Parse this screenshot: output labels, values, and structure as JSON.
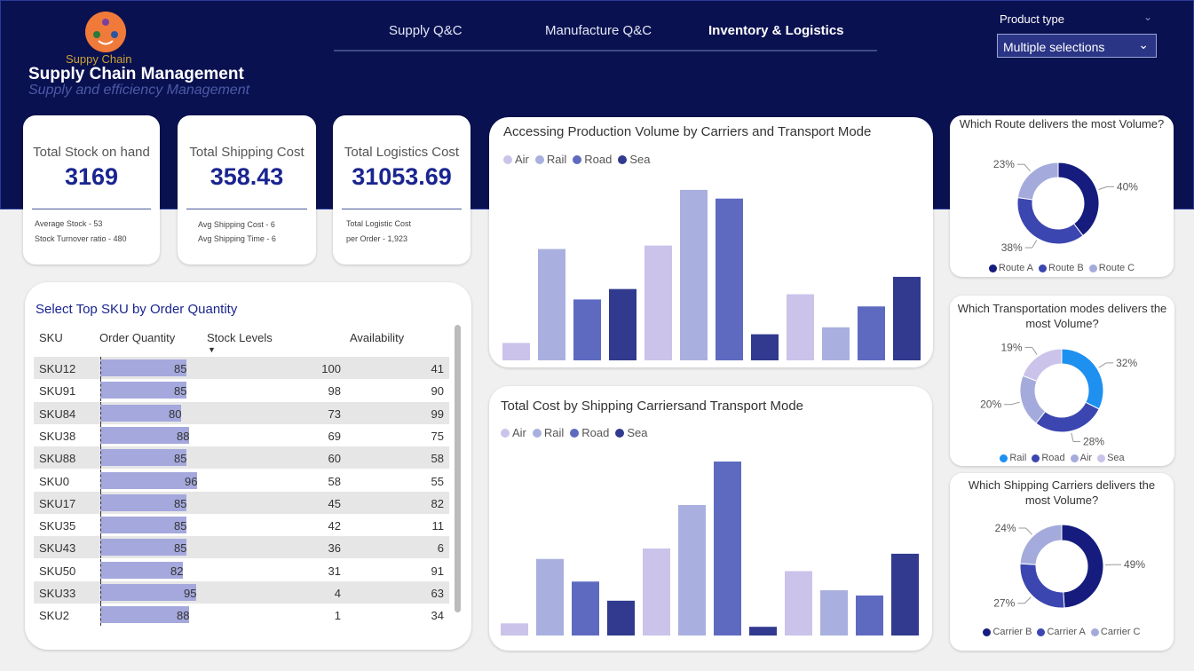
{
  "header": {
    "logo_text": "Suppy Chain",
    "title": "Supply Chain Management",
    "subtitle": "Supply and efficiency Management",
    "nav_tabs": [
      {
        "label": "Supply Q&C",
        "active": false
      },
      {
        "label": "Manufacture Q&C",
        "active": false
      },
      {
        "label": "Inventory & Logistics",
        "active": true
      }
    ],
    "filter": {
      "label": "Product type",
      "value": "Multiple selections"
    }
  },
  "kpis": [
    {
      "title": "Total Stock on hand",
      "value": "3169",
      "sub": [
        "Average Stock  -    53",
        "Stock Turnover ratio  -    480"
      ]
    },
    {
      "title": "Total Shipping Cost",
      "value": "358.43",
      "sub": [
        "Avg Shipping Cost - 6",
        "Avg Shipping Time - 6"
      ]
    },
    {
      "title": "Total Logistics Cost",
      "value": "31053.69",
      "sub": [
        "Total Logistic Cost",
        "per Order -    1,923"
      ]
    }
  ],
  "colors": {
    "Air": "#cbc3ea",
    "Rail": "#a9b0df",
    "Road": "#5e6ac0",
    "Sea": "#313a8e",
    "Rail_blue": "#1e90f0"
  },
  "chart_data": [
    {
      "type": "bar",
      "title": "Accessing Production Volume by Carriers and Transport Mode",
      "legend": [
        "Air",
        "Rail",
        "Road",
        "Sea"
      ],
      "bars": [
        {
          "mode": "Air",
          "value": 10
        },
        {
          "mode": "Rail",
          "value": 64
        },
        {
          "mode": "Road",
          "value": 35
        },
        {
          "mode": "Sea",
          "value": 41
        },
        {
          "mode": "Air",
          "value": 66
        },
        {
          "mode": "Rail",
          "value": 98
        },
        {
          "mode": "Road",
          "value": 93
        },
        {
          "mode": "Sea",
          "value": 15
        },
        {
          "mode": "Air",
          "value": 38
        },
        {
          "mode": "Rail",
          "value": 19
        },
        {
          "mode": "Road",
          "value": 31
        },
        {
          "mode": "Sea",
          "value": 48
        }
      ],
      "ylim": [
        0,
        100
      ]
    },
    {
      "type": "bar",
      "title": "Total Cost by Shipping Carriersand Transport Mode",
      "legend": [
        "Air",
        "Rail",
        "Road",
        "Sea"
      ],
      "bars": [
        {
          "mode": "Air",
          "value": 7
        },
        {
          "mode": "Rail",
          "value": 44
        },
        {
          "mode": "Road",
          "value": 31
        },
        {
          "mode": "Sea",
          "value": 20
        },
        {
          "mode": "Air",
          "value": 50
        },
        {
          "mode": "Rail",
          "value": 75
        },
        {
          "mode": "Road",
          "value": 100
        },
        {
          "mode": "Sea",
          "value": 5
        },
        {
          "mode": "Air",
          "value": 37
        },
        {
          "mode": "Rail",
          "value": 26
        },
        {
          "mode": "Road",
          "value": 23
        },
        {
          "mode": "Sea",
          "value": 47
        }
      ],
      "ylim": [
        0,
        100
      ]
    },
    {
      "type": "pie",
      "title": "Which Route delivers the most Volume?",
      "slices": [
        {
          "name": "Route A",
          "value": 40,
          "label": "40%",
          "color": "#151c7e"
        },
        {
          "name": "Route B",
          "value": 38,
          "label": "38%",
          "color": "#3b46b0"
        },
        {
          "name": "Route C",
          "value": 23,
          "label": "23%",
          "color": "#a4abdc"
        }
      ]
    },
    {
      "type": "pie",
      "title": "Which Transportation modes delivers the most Volume?",
      "slices": [
        {
          "name": "Rail",
          "value": 32,
          "label": "32%",
          "color": "#1e90f0"
        },
        {
          "name": "Road",
          "value": 28,
          "label": "28%",
          "color": "#3b46b0"
        },
        {
          "name": "Air",
          "value": 20,
          "label": "20%",
          "color": "#a4abdc"
        },
        {
          "name": "Sea",
          "value": 19,
          "label": "19%",
          "color": "#cbc3ea"
        }
      ]
    },
    {
      "type": "pie",
      "title": "Which Shipping Carriers delivers the most Volume?",
      "slices": [
        {
          "name": "Carrier B",
          "value": 49,
          "label": "49%",
          "color": "#151c7e"
        },
        {
          "name": "Carrier A",
          "value": 27,
          "label": "27%",
          "color": "#3b46b0"
        },
        {
          "name": "Carrier C",
          "value": 24,
          "label": "24%",
          "color": "#a4abdc"
        }
      ]
    }
  ],
  "sku_table": {
    "title": "Select Top SKU by Order Quantity",
    "columns": [
      "SKU",
      "Order Quantity",
      "Stock Levels",
      "Availability"
    ],
    "sort_icon": "sort-desc-icon",
    "rows": [
      [
        "SKU12",
        "85",
        "100",
        "41"
      ],
      [
        "SKU91",
        "85",
        "98",
        "90"
      ],
      [
        "SKU84",
        "80",
        "73",
        "99"
      ],
      [
        "SKU38",
        "88",
        "69",
        "75"
      ],
      [
        "SKU88",
        "85",
        "60",
        "58"
      ],
      [
        "SKU0",
        "96",
        "58",
        "55"
      ],
      [
        "SKU17",
        "85",
        "45",
        "82"
      ],
      [
        "SKU35",
        "85",
        "42",
        "11"
      ],
      [
        "SKU43",
        "85",
        "36",
        "6"
      ],
      [
        "SKU50",
        "82",
        "31",
        "91"
      ],
      [
        "SKU33",
        "95",
        "4",
        "63"
      ],
      [
        "SKU2",
        "88",
        "1",
        "34"
      ]
    ]
  }
}
